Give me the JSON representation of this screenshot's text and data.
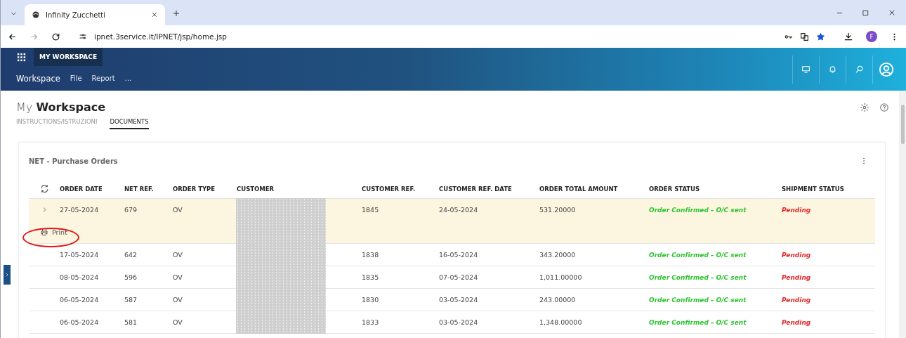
{
  "browser": {
    "tabs": [
      {
        "title": "Infinity Zucchetti",
        "selected": true
      }
    ],
    "url": "ipnet.3service.it/IPNET/jsp/home.jsp",
    "profile_initial": "F"
  },
  "app_header": {
    "section": "MY WORKSPACE",
    "menu": [
      {
        "label": "Workspace",
        "selected": true
      },
      {
        "label": "File",
        "selected": false
      },
      {
        "label": "Report",
        "selected": false
      },
      {
        "label": "...",
        "selected": false
      }
    ]
  },
  "page": {
    "title_light": "My",
    "title_bold": "Workspace",
    "tabs": [
      {
        "label": "INSTRUCTIONS/ISTRUZIONI",
        "selected": false
      },
      {
        "label": "DOCUMENTS",
        "selected": true
      }
    ]
  },
  "card": {
    "title": "NET - Purchase Orders",
    "columns": [
      "ORDER DATE",
      "NET REF.",
      "ORDER TYPE",
      "CUSTOMER",
      "CUSTOMER REF.",
      "CUSTOMER REF. DATE",
      "ORDER TOTAL AMOUNT",
      "ORDER STATUS",
      "SHIPMENT STATUS"
    ],
    "rows": [
      {
        "expanded": true,
        "action": "Print",
        "order_date": "27-05-2024",
        "net_ref": "679",
        "order_type": "OV",
        "customer_ref": "1845",
        "customer_ref_date": "24-05-2024",
        "total": "531.20000",
        "order_status": "Order Confirmed – O/C sent",
        "shipment_status": "Pending"
      },
      {
        "expanded": false,
        "order_date": "17-05-2024",
        "net_ref": "642",
        "order_type": "OV",
        "customer_ref": "1838",
        "customer_ref_date": "16-05-2024",
        "total": "343.20000",
        "order_status": "Order Confirmed – O/C sent",
        "shipment_status": "Pending"
      },
      {
        "expanded": false,
        "order_date": "08-05-2024",
        "net_ref": "596",
        "order_type": "OV",
        "customer_ref": "1835",
        "customer_ref_date": "07-05-2024",
        "total": "1,011.00000",
        "order_status": "Order Confirmed – O/C sent",
        "shipment_status": "Pending"
      },
      {
        "expanded": false,
        "order_date": "06-05-2024",
        "net_ref": "587",
        "order_type": "OV",
        "customer_ref": "1830",
        "customer_ref_date": "03-05-2024",
        "total": "243.00000",
        "order_status": "Order Confirmed – O/C sent",
        "shipment_status": "Pending"
      },
      {
        "expanded": false,
        "order_date": "06-05-2024",
        "net_ref": "581",
        "order_type": "OV",
        "customer_ref": "1833",
        "customer_ref_date": "03-05-2024",
        "total": "1,348.00000",
        "order_status": "Order Confirmed – O/C sent",
        "shipment_status": "Pending"
      }
    ]
  }
}
